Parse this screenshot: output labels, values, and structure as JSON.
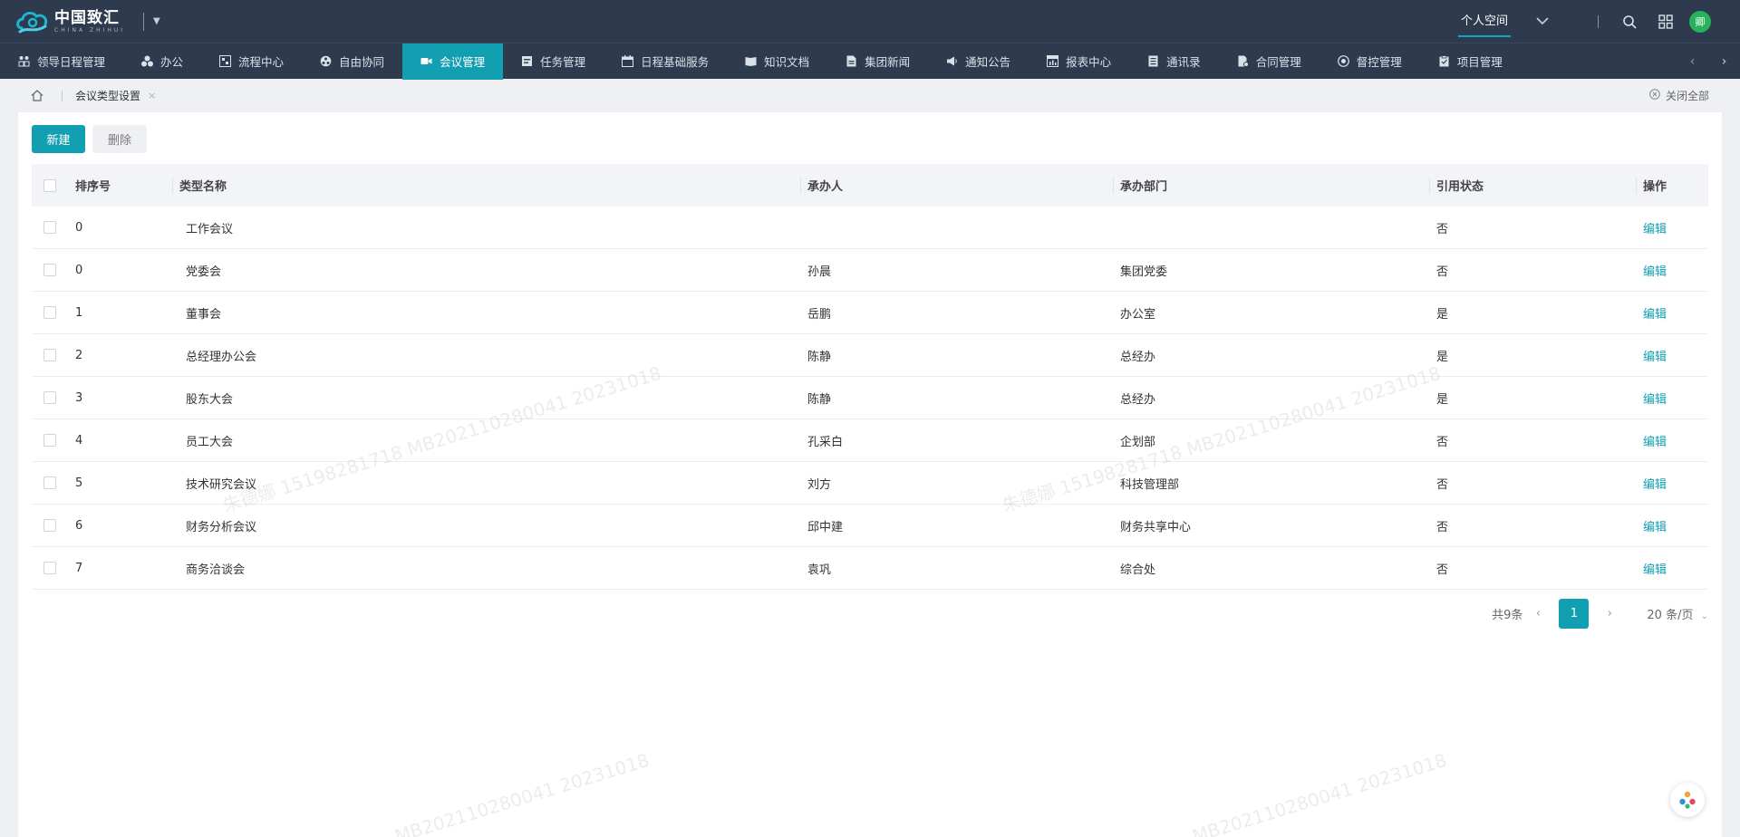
{
  "header": {
    "logo_cn": "中国致汇",
    "logo_en": "CHINA ZHIHUI",
    "personal_space": "个人空间",
    "avatar_text": "卿"
  },
  "nav": {
    "items": [
      {
        "label": "领导日程管理",
        "icon": "people-icon"
      },
      {
        "label": "办公",
        "icon": "office-icon"
      },
      {
        "label": "流程中心",
        "icon": "flow-icon"
      },
      {
        "label": "自由协同",
        "icon": "cooperate-icon"
      },
      {
        "label": "会议管理",
        "icon": "video-icon"
      },
      {
        "label": "任务管理",
        "icon": "task-icon"
      },
      {
        "label": "日程基础服务",
        "icon": "calendar-icon"
      },
      {
        "label": "知识文档",
        "icon": "book-icon"
      },
      {
        "label": "集团新闻",
        "icon": "news-icon"
      },
      {
        "label": "通知公告",
        "icon": "megaphone-icon"
      },
      {
        "label": "报表中心",
        "icon": "report-icon"
      },
      {
        "label": "通讯录",
        "icon": "contacts-icon"
      },
      {
        "label": "合同管理",
        "icon": "contract-icon"
      },
      {
        "label": "督控管理",
        "icon": "supervise-icon"
      },
      {
        "label": "项目管理",
        "icon": "project-icon"
      }
    ],
    "active_index": 4
  },
  "breadcrumb": {
    "tab": "会议类型设置",
    "close_all": "关闭全部"
  },
  "toolbar": {
    "new_label": "新建",
    "delete_label": "删除"
  },
  "table": {
    "columns": [
      "排序号",
      "类型名称",
      "承办人",
      "承办部门",
      "引用状态",
      "操作"
    ],
    "rows": [
      {
        "sort": "0",
        "name": "工作会议",
        "person": "",
        "dept": "",
        "status": "否",
        "op": "编辑"
      },
      {
        "sort": "0",
        "name": "党委会",
        "person": "孙晨",
        "dept": "集团党委",
        "status": "否",
        "op": "编辑"
      },
      {
        "sort": "1",
        "name": "董事会",
        "person": "岳鹏",
        "dept": "办公室",
        "status": "是",
        "op": "编辑"
      },
      {
        "sort": "2",
        "name": "总经理办公会",
        "person": "陈静",
        "dept": "总经办",
        "status": "是",
        "op": "编辑"
      },
      {
        "sort": "3",
        "name": "股东大会",
        "person": "陈静",
        "dept": "总经办",
        "status": "是",
        "op": "编辑"
      },
      {
        "sort": "4",
        "name": "员工大会",
        "person": "孔采白",
        "dept": "企划部",
        "status": "否",
        "op": "编辑"
      },
      {
        "sort": "5",
        "name": "技术研究会议",
        "person": "刘方",
        "dept": "科技管理部",
        "status": "否",
        "op": "编辑"
      },
      {
        "sort": "6",
        "name": "财务分析会议",
        "person": "邱中建",
        "dept": "财务共享中心",
        "status": "否",
        "op": "编辑"
      },
      {
        "sort": "7",
        "name": "商务洽谈会",
        "person": "袁巩",
        "dept": "综合处",
        "status": "否",
        "op": "编辑"
      }
    ]
  },
  "pager": {
    "total": "共9条",
    "current": "1",
    "page_size": "20 条/页"
  },
  "watermarks": [
    "朱德娜 15198281718 MB202110280041 20231018",
    "朱德娜 15198281718 MB202110280041 20231018",
    "MB202110280041 20231018",
    "MB202110280041 20231018"
  ],
  "colors": {
    "header_bg": "#2e3a4d",
    "accent": "#139fb2",
    "avatar": "#27b35d"
  }
}
